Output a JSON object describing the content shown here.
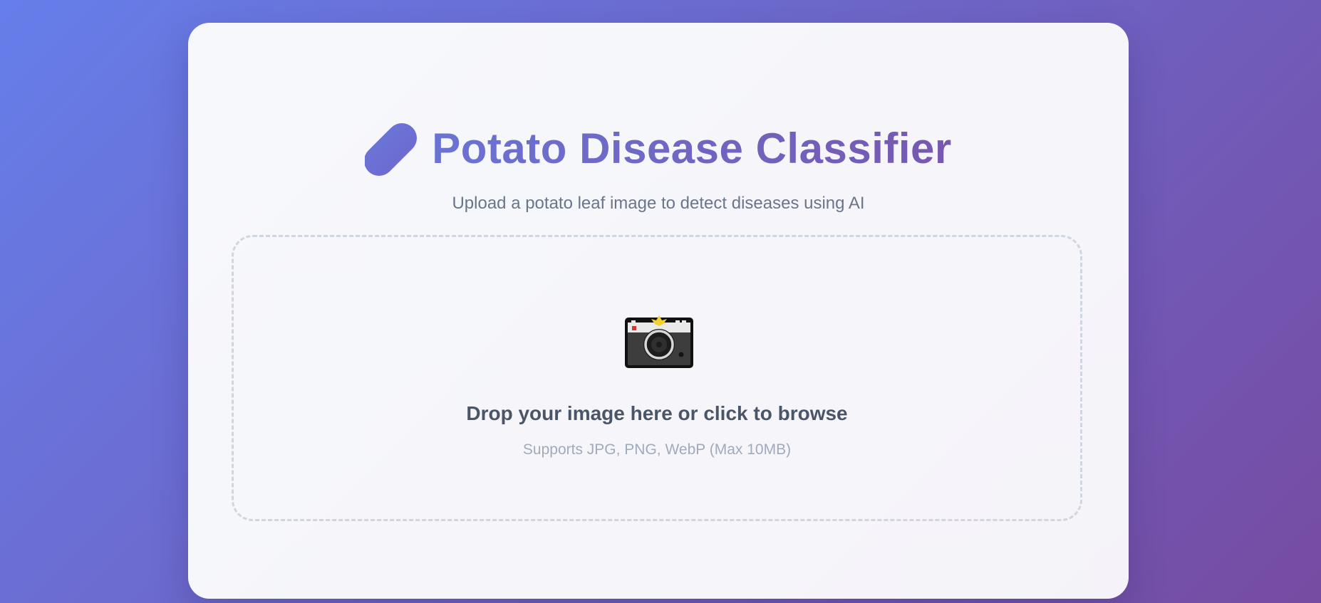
{
  "header": {
    "title": "Potato Disease Classifier",
    "subtitle": "Upload a potato leaf image to detect diseases using AI",
    "icon": "potato-icon"
  },
  "upload": {
    "icon": "camera-icon",
    "title": "Drop your image here or click to browse",
    "hint": "Supports JPG, PNG, WebP (Max 10MB)"
  },
  "colors": {
    "background_start": "#667eea",
    "background_end": "#764ba2",
    "title_start": "#6a73d4",
    "title_end": "#7658b0",
    "dropzone_border": "#cfd6e0"
  }
}
